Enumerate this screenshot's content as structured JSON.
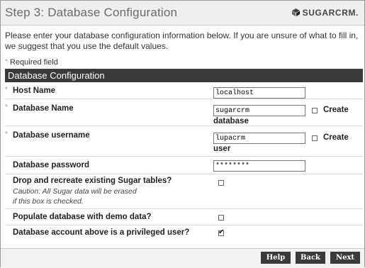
{
  "header": {
    "title": "Step 3: Database Configuration",
    "brand": "SUGARCRM."
  },
  "intro": "Please enter your database configuration information below. If you are unsure of what to fill in, we suggest that you use the default values.",
  "required_note": "Required field",
  "required_marker": "*",
  "section_title": "Database Configuration",
  "fields": {
    "host": {
      "label": "Host Name",
      "value": "localhost"
    },
    "db_name": {
      "label": "Database Name",
      "value": "sugarcrm",
      "create_label_1": "Create",
      "create_label_2": "database"
    },
    "db_user": {
      "label": "Database username",
      "value": "lupacrm",
      "create_label_1": "Create",
      "create_label_2": "user"
    },
    "db_pass": {
      "label": "Database password",
      "value": "********"
    },
    "drop_tables": {
      "label": "Drop and recreate existing Sugar tables?",
      "note_1": "Caution: All Sugar data will be erased",
      "note_2": "if this box is checked."
    },
    "demo_data": {
      "label": "Populate database with demo data?"
    },
    "privileged": {
      "label": "Database account above is a privileged user?"
    }
  },
  "buttons": {
    "help": "Help",
    "back": "Back",
    "next": "Next"
  }
}
